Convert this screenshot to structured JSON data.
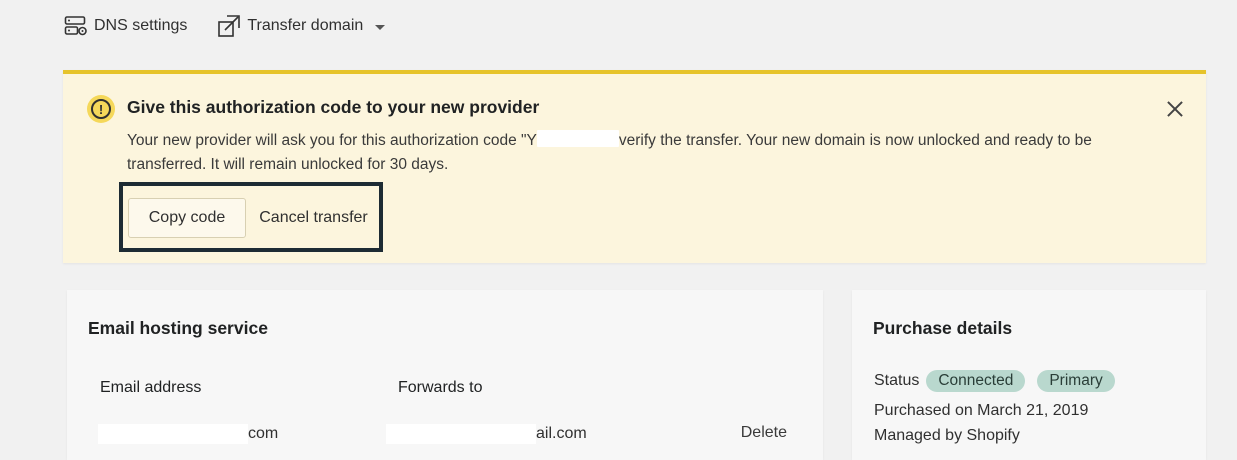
{
  "toolbar": {
    "dns_label": "DNS settings",
    "transfer_label": "Transfer domain"
  },
  "banner": {
    "title": "Give this authorization code to your new provider",
    "text_before": "Your new provider will ask you for this authorization code \"Y",
    "text_after": "verify the transfer. Your new domain is now unlocked and ready to be transferred. It will remain unlocked for 30 days.",
    "copy_button": "Copy code",
    "cancel_button": "Cancel transfer",
    "accent_color": "#e6c32a"
  },
  "email_card": {
    "title": "Email hosting service",
    "col_email": "Email address",
    "col_forward": "Forwards to",
    "row": {
      "email_suffix": "com",
      "forward_suffix": "ail.com",
      "delete_label": "Delete"
    }
  },
  "purchase_card": {
    "title": "Purchase details",
    "status_label": "Status",
    "badges": [
      "Connected",
      "Primary"
    ],
    "purchased_on": "Purchased on March 21, 2019",
    "managed_by": "Managed by Shopify"
  }
}
